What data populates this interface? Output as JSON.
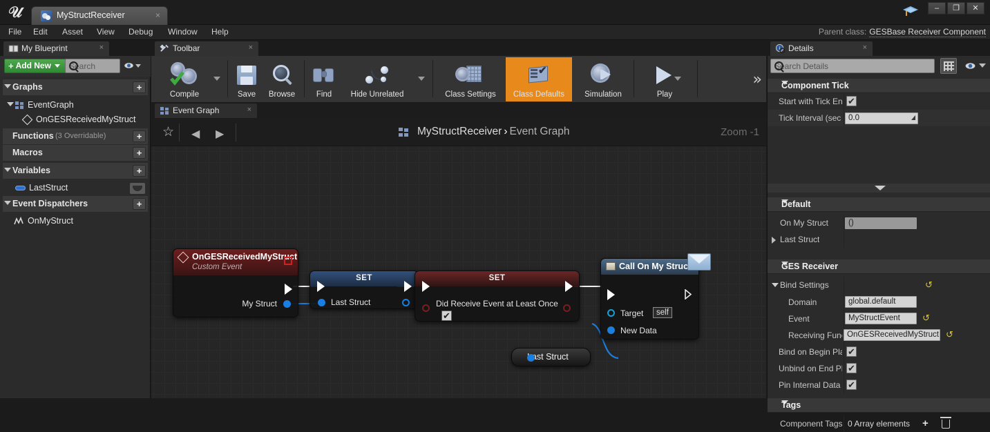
{
  "titlebar": {
    "tab_label": "MyStructReceiver",
    "tab_close": "×",
    "minimize": "–",
    "maximize": "❐",
    "close": "✕"
  },
  "menubar": {
    "items": [
      "File",
      "Edit",
      "Asset",
      "View",
      "Debug",
      "Window",
      "Help"
    ],
    "parent_class_label": "Parent class:",
    "parent_class_value": "GESBase Receiver Component"
  },
  "my_blueprint": {
    "tab_label": "My Blueprint",
    "tab_close": "×",
    "add_new_label": "Add New",
    "search_placeholder": "Search",
    "sections": [
      {
        "label": "Graphs",
        "has_plus": true
      },
      {
        "label": "EventGraph",
        "has_plus": false
      },
      {
        "label": "OnGESReceivedMyStruct",
        "has_plus": false
      },
      {
        "label": "Functions",
        "sub": "(3 Overridable)",
        "has_plus": true
      },
      {
        "label": "Macros",
        "has_plus": true
      },
      {
        "label": "Variables",
        "has_plus": true
      },
      {
        "label": "LastStruct",
        "has_plus": false
      },
      {
        "label": "Event Dispatchers",
        "has_plus": true
      },
      {
        "label": "OnMyStruct",
        "has_plus": false
      }
    ],
    "plus_glyph": "+"
  },
  "toolbar": {
    "tab_label": "Toolbar",
    "tab_close": "×",
    "buttons": [
      {
        "label": "Compile",
        "icon": "compile-gear-check-icon",
        "dropdown": true
      },
      {
        "label": "Save",
        "icon": "floppy-disk-icon",
        "dropdown": false
      },
      {
        "label": "Browse",
        "icon": "magnifier-icon",
        "dropdown": false
      },
      {
        "label": "Find",
        "icon": "binoculars-icon",
        "dropdown": false
      },
      {
        "label": "Hide Unrelated",
        "icon": "node-graph-icon",
        "dropdown": true
      },
      {
        "label": "Class Settings",
        "icon": "gear-sheet-icon",
        "dropdown": false
      },
      {
        "label": "Class Defaults",
        "icon": "checklist-icon",
        "dropdown": false,
        "active": true
      },
      {
        "label": "Simulation",
        "icon": "gear-play-icon",
        "dropdown": false
      },
      {
        "label": "Play",
        "icon": "play-triangle-icon",
        "dropdown": true
      }
    ],
    "overflow_glyph": "»"
  },
  "graph_tab": {
    "label": "Event Graph",
    "close": "×"
  },
  "breadcrumb": {
    "star": "☆",
    "back": "◀",
    "forward": "▶",
    "root": "MyStructReceiver",
    "separator": "›",
    "current": "Event Graph",
    "zoom_label": "Zoom -1"
  },
  "graph": {
    "nodes": [
      {
        "id": "custom-event",
        "title": "OnGESReceivedMyStruct",
        "subtitle": "Custom Event",
        "out_data_pin": "My Struct"
      },
      {
        "id": "set-last-struct",
        "title": "SET",
        "in_data_pin": "Last Struct"
      },
      {
        "id": "set-did-receive",
        "title": "SET",
        "in_data_pin": "Did Receive Event at Least Once",
        "checkbox": "✔"
      },
      {
        "id": "call-on-my-struct",
        "title": "Call On My Struct",
        "target_label": "Target",
        "target_value": "self",
        "new_data_label": "New Data"
      },
      {
        "id": "last-struct-getter",
        "title": "Last Struct"
      }
    ]
  },
  "details": {
    "tab_label": "Details",
    "tab_close": "×",
    "search_placeholder": "Search Details",
    "sections": [
      {
        "name": "Component Tick",
        "rows": [
          {
            "label": "Start with Tick En",
            "type": "checkbox",
            "value": "✔"
          },
          {
            "label": "Tick Interval (sec",
            "type": "number",
            "value": "0.0"
          }
        ]
      },
      {
        "name": "Default",
        "rows": [
          {
            "label": "On My Struct",
            "type": "text",
            "value": "()"
          },
          {
            "label": "Last Struct",
            "type": "expandable",
            "value": ""
          }
        ]
      },
      {
        "name": "GES Receiver",
        "rows": [
          {
            "label": "Bind Settings",
            "type": "group",
            "reset": "↺"
          },
          {
            "label": "Domain",
            "type": "text",
            "value": "global.default"
          },
          {
            "label": "Event",
            "type": "text",
            "value": "MyStructEvent",
            "reset": "↺"
          },
          {
            "label": "Receiving Funct",
            "type": "text",
            "value": "OnGESReceivedMyStruct",
            "reset": "↺"
          },
          {
            "label": "Bind on Begin Pla",
            "type": "checkbox",
            "value": "✔"
          },
          {
            "label": "Unbind on End Pla",
            "type": "checkbox",
            "value": "✔"
          },
          {
            "label": "Pin Internal Data t",
            "type": "checkbox",
            "value": "✔"
          }
        ]
      },
      {
        "name": "Tags",
        "rows": [
          {
            "label": "Component Tags",
            "type": "array",
            "value": "0 Array elements",
            "plus": "+"
          }
        ]
      }
    ]
  },
  "colors": {
    "accent_orange": "#e8891c",
    "add_new_green": "#3f9b42",
    "exec_wire": "#f0f0f0",
    "data_wire_blue": "#1a7fe0",
    "event_header_red": "#6e1e1e",
    "set_header_blue": "#33517c",
    "reset_yellow": "#e0c723"
  }
}
